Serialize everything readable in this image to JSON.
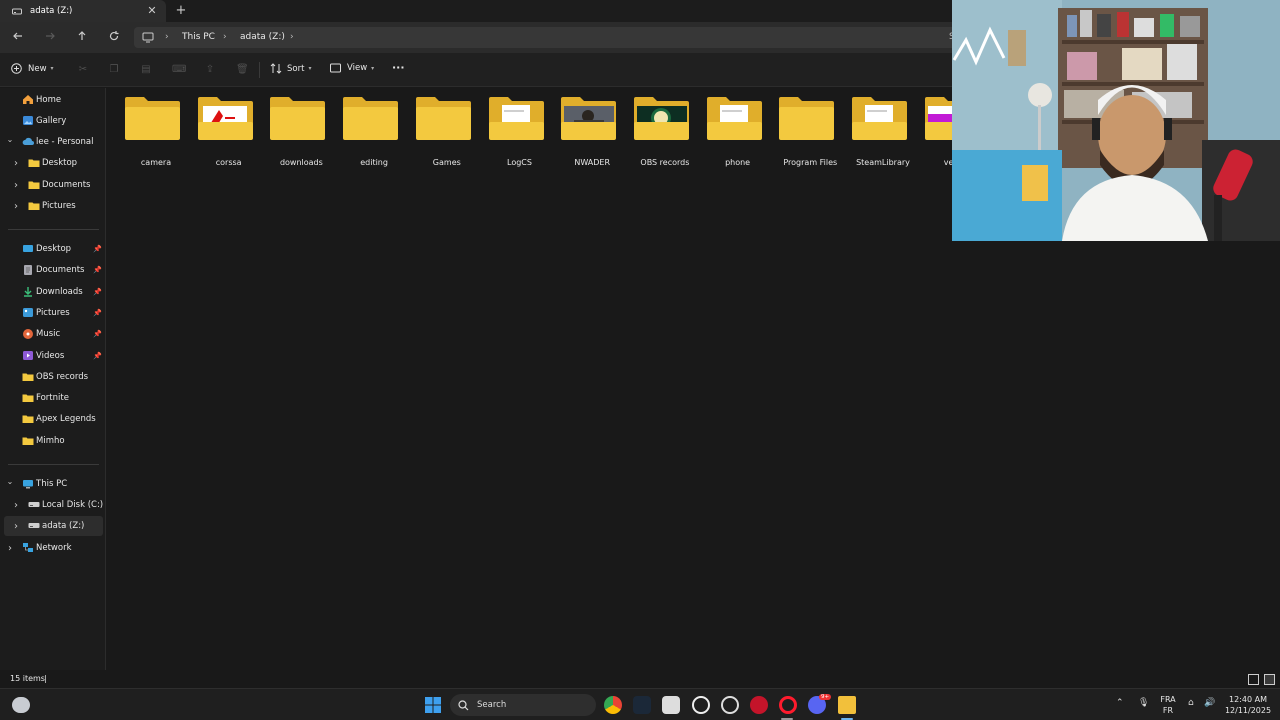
{
  "window": {
    "tab_title": "adata (Z:)",
    "tab_close": "✕",
    "new_tab": "+"
  },
  "address_bar": {
    "crumbs": [
      "This PC",
      "adata (Z:)"
    ],
    "search_stub": "S"
  },
  "toolbar": {
    "new_label": "New",
    "sort_label": "Sort",
    "view_label": "View",
    "more": "···"
  },
  "sidebar": {
    "top": [
      {
        "label": "Home",
        "icon": "home-icon"
      },
      {
        "label": "Gallery",
        "icon": "gallery-icon"
      },
      {
        "label": "lee - Personal",
        "icon": "onedrive-cloud-icon"
      },
      {
        "label": "Desktop",
        "icon": "folder-icon"
      },
      {
        "label": "Documents",
        "icon": "folder-icon"
      },
      {
        "label": "Pictures",
        "icon": "folder-icon"
      }
    ],
    "pinned": [
      {
        "label": "Desktop",
        "icon": "desktop-icon",
        "pinned": true
      },
      {
        "label": "Documents",
        "icon": "documents-icon",
        "pinned": true
      },
      {
        "label": "Downloads",
        "icon": "download-icon",
        "pinned": true
      },
      {
        "label": "Pictures",
        "icon": "pictures-icon",
        "pinned": true
      },
      {
        "label": "Music",
        "icon": "music-icon",
        "pinned": true
      },
      {
        "label": "Videos",
        "icon": "videos-icon",
        "pinned": true
      },
      {
        "label": "OBS records",
        "icon": "folder-icon",
        "pinned": false
      },
      {
        "label": "Fortnite",
        "icon": "folder-icon",
        "pinned": false
      },
      {
        "label": "Apex Legends",
        "icon": "folder-icon",
        "pinned": false
      },
      {
        "label": "Mimho",
        "icon": "folder-icon",
        "pinned": false
      }
    ],
    "drives": [
      {
        "label": "This PC",
        "icon": "pc-icon"
      },
      {
        "label": "Local Disk (C:)",
        "icon": "drive-icon"
      },
      {
        "label": "adata (Z:)",
        "icon": "drive-icon",
        "selected": true
      },
      {
        "label": "Network",
        "icon": "network-icon"
      }
    ]
  },
  "folders": [
    {
      "name": "camera",
      "preview": "none"
    },
    {
      "name": "corssa",
      "preview": "red-logo"
    },
    {
      "name": "downloads",
      "preview": "none"
    },
    {
      "name": "editing",
      "preview": "none"
    },
    {
      "name": "Games",
      "preview": "none"
    },
    {
      "name": "LogCS",
      "preview": "document"
    },
    {
      "name": "NWADER",
      "preview": "photo"
    },
    {
      "name": "OBS records",
      "preview": "green-screen"
    },
    {
      "name": "phone",
      "preview": "document"
    },
    {
      "name": "Program Files",
      "preview": "none"
    },
    {
      "name": "SteamLibrary",
      "preview": "document"
    },
    {
      "name": "vegas",
      "preview": "purple"
    }
  ],
  "status": {
    "item_count": "15 items",
    "cursor": "|"
  },
  "taskbar": {
    "search_placeholder": "Search",
    "lang_top": "FRA",
    "lang_bottom": "FR",
    "time": "12:40 AM",
    "date": "12/11/2025",
    "discord_badge": "9+"
  },
  "colors": {
    "folder_yellow": "#f3c93f",
    "folder_back": "#e0ae2b",
    "accent_blue": "#4a9ed8",
    "webcam_wall": "#8fb3c2"
  }
}
